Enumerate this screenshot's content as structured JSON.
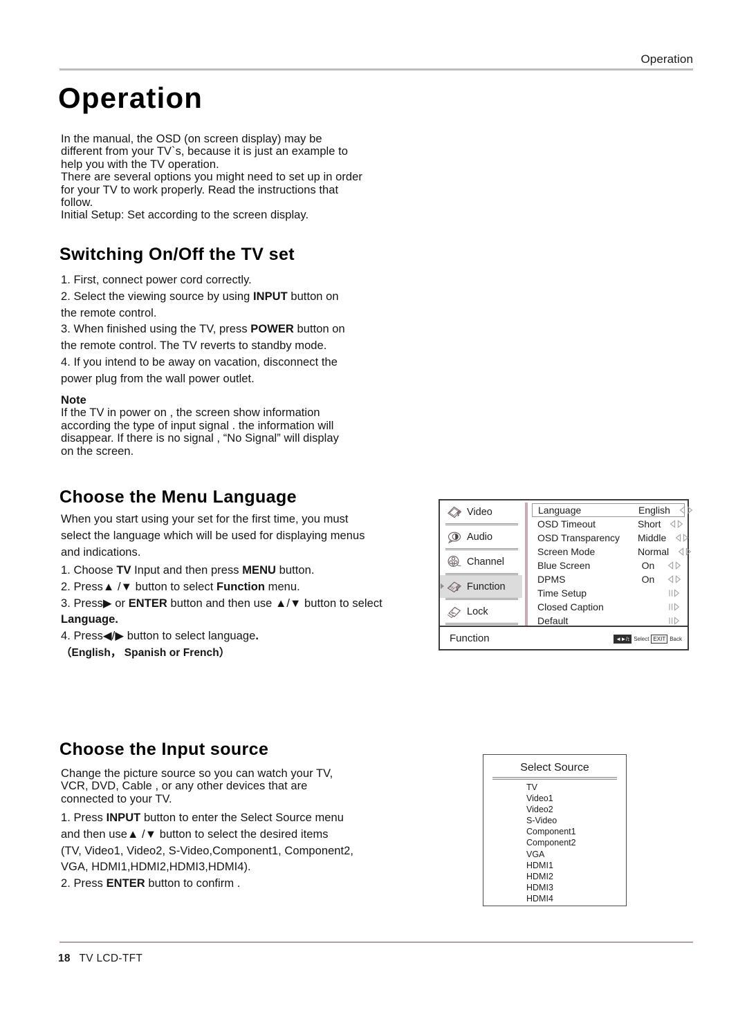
{
  "running_head": "Operation",
  "page_title": "Operation",
  "intro": [
    "In the manual, the OSD (on screen display) may be",
    "different from your TV`s,  because it is just an example to",
    "help you with the TV operation.",
    "There are several options you might need to set up in order",
    "for your TV to work properly.  Read the instructions that",
    "follow.",
    "Initial Setup: Set according to the screen display."
  ],
  "section_switching": {
    "heading": "Switching On/Off the TV set",
    "steps": [
      "1. First, connect power cord correctly.",
      "2. Select the viewing source by using INPUT button on",
      "the remote control.",
      "3. When finished using the TV, press POWER button on",
      "the remote control. The TV reverts to standby mode.",
      "4. If you intend to be away on vacation, disconnect the",
      "power plug from the wall power outlet."
    ],
    "note_label": "Note",
    "note_lines": [
      "If the TV in power on , the screen show information",
      "according the type of input signal . the information will",
      "disappear. If there is no signal , “No Signal”  will display",
      "on the screen."
    ]
  },
  "section_language": {
    "heading": "Choose the Menu Language",
    "paragraph": [
      "When you start using your set for the first time, you must",
      "select the language which will be used for displaying menus",
      "and indications."
    ],
    "steps": [
      "1. Choose TV Input and then press MENU button.",
      "2. Press ▲ / ▼ button to select Function menu.",
      "3. Press ▶ or ENTER button and then use ▲ / ▼ button to select",
      "Language.",
      "4. Press ◀ / ▶ button to select language.",
      "（English， Spanish or French）"
    ]
  },
  "osd_menu": {
    "sidebar": [
      {
        "label": "Video",
        "icon": "video-icon",
        "selected": false
      },
      {
        "label": "Audio",
        "icon": "audio-icon",
        "selected": false
      },
      {
        "label": "Channel",
        "icon": "channel-icon",
        "selected": false
      },
      {
        "label": "Function",
        "icon": "function-icon",
        "selected": true
      },
      {
        "label": "Lock",
        "icon": "lock-icon",
        "selected": false
      }
    ],
    "rows": [
      {
        "name": "Language",
        "value": "English",
        "arrow": "lr",
        "highlight": true
      },
      {
        "name": "OSD Timeout",
        "value": "Short",
        "arrow": "lr",
        "highlight": false
      },
      {
        "name": "OSD Transparency",
        "value": "Middle",
        "arrow": "lr",
        "highlight": false
      },
      {
        "name": "Screen Mode",
        "value": "Normal",
        "arrow": "lr",
        "highlight": false
      },
      {
        "name": "Blue Screen",
        "value": "On",
        "arrow": "lr",
        "highlight": false
      },
      {
        "name": "DPMS",
        "value": "On",
        "arrow": "lr",
        "highlight": false
      },
      {
        "name": "Time Setup",
        "value": "",
        "arrow": "submenu",
        "highlight": false
      },
      {
        "name": "Closed Caption",
        "value": "",
        "arrow": "submenu",
        "highlight": false
      },
      {
        "name": "Default",
        "value": "",
        "arrow": "submenu",
        "highlight": false
      }
    ],
    "footer_label": "Function",
    "hint_select": "Select",
    "hint_exit": "EXIT",
    "hint_back": "Back",
    "accent_color": "#cbaab0"
  },
  "section_input": {
    "heading": "Choose the Input source",
    "paragraph": [
      "Change the picture source so you can watch your TV,",
      "VCR, DVD, Cable , or any other devices that are",
      "connected to your TV."
    ],
    "steps": [
      "1. Press INPUT button to enter the Select Source menu",
      "and then use ▲ / ▼ button to select the desired items",
      "(TV, Video1, Video2, S-Video,Component1, Component2,",
      "VGA, HDMI1,HDMI2,HDMI3,HDMI4).",
      "2. Press ENTER button to confirm ."
    ]
  },
  "select_source": {
    "title": "Select Source",
    "items": [
      "TV",
      "Video1",
      "Video2",
      "S-Video",
      "Component1",
      "Component2",
      "VGA",
      "HDMI1",
      "HDMI2",
      "HDMI3",
      "HDMI4"
    ]
  },
  "footer": {
    "page_number": "18",
    "model": "TV LCD-TFT"
  }
}
